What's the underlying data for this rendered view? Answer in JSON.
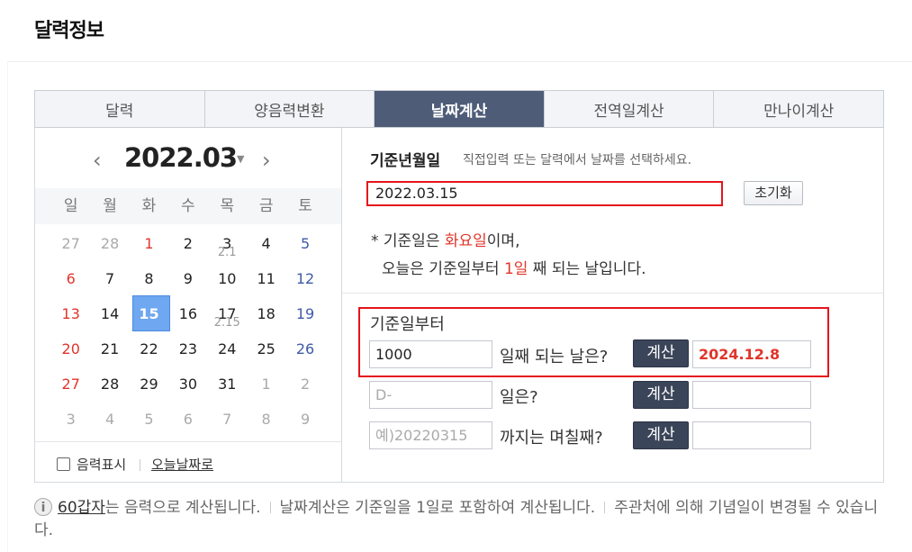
{
  "page_title": "달력정보",
  "tabs": [
    {
      "label": "달력",
      "active": false
    },
    {
      "label": "양음력변환",
      "active": false
    },
    {
      "label": "날짜계산",
      "active": true
    },
    {
      "label": "전역일계산",
      "active": false
    },
    {
      "label": "만나이계산",
      "active": false
    }
  ],
  "calendar": {
    "month_label": "2022.03",
    "prev_icon": "chevron-left-icon",
    "next_icon": "chevron-right-icon",
    "weekdays": [
      "일",
      "월",
      "화",
      "수",
      "목",
      "금",
      "토"
    ],
    "weeks": [
      [
        {
          "d": "27",
          "c": "muted"
        },
        {
          "d": "28",
          "c": "muted"
        },
        {
          "d": "1",
          "c": "red"
        },
        {
          "d": "2",
          "c": "normal"
        },
        {
          "d": "3",
          "c": "normal",
          "lunar": "2.1"
        },
        {
          "d": "4",
          "c": "normal"
        },
        {
          "d": "5",
          "c": "blue"
        }
      ],
      [
        {
          "d": "6",
          "c": "red"
        },
        {
          "d": "7",
          "c": "normal"
        },
        {
          "d": "8",
          "c": "normal"
        },
        {
          "d": "9",
          "c": "normal"
        },
        {
          "d": "10",
          "c": "normal"
        },
        {
          "d": "11",
          "c": "normal"
        },
        {
          "d": "12",
          "c": "blue"
        }
      ],
      [
        {
          "d": "13",
          "c": "red"
        },
        {
          "d": "14",
          "c": "normal"
        },
        {
          "d": "15",
          "c": "normal",
          "selected": true
        },
        {
          "d": "16",
          "c": "normal"
        },
        {
          "d": "17",
          "c": "normal",
          "lunar": "2.15"
        },
        {
          "d": "18",
          "c": "normal"
        },
        {
          "d": "19",
          "c": "blue"
        }
      ],
      [
        {
          "d": "20",
          "c": "red"
        },
        {
          "d": "21",
          "c": "normal"
        },
        {
          "d": "22",
          "c": "normal"
        },
        {
          "d": "23",
          "c": "normal"
        },
        {
          "d": "24",
          "c": "normal"
        },
        {
          "d": "25",
          "c": "normal"
        },
        {
          "d": "26",
          "c": "blue"
        }
      ],
      [
        {
          "d": "27",
          "c": "red"
        },
        {
          "d": "28",
          "c": "normal"
        },
        {
          "d": "29",
          "c": "normal"
        },
        {
          "d": "30",
          "c": "normal"
        },
        {
          "d": "31",
          "c": "normal"
        },
        {
          "d": "1",
          "c": "muted"
        },
        {
          "d": "2",
          "c": "muted"
        }
      ],
      [
        {
          "d": "3",
          "c": "muted"
        },
        {
          "d": "4",
          "c": "muted"
        },
        {
          "d": "5",
          "c": "muted"
        },
        {
          "d": "6",
          "c": "muted"
        },
        {
          "d": "7",
          "c": "muted"
        },
        {
          "d": "8",
          "c": "muted"
        },
        {
          "d": "9",
          "c": "muted"
        }
      ]
    ],
    "lunar_checkbox_label": "음력표시",
    "today_link": "오늘날짜로"
  },
  "base": {
    "label": "기준년월일",
    "hint": "직접입력 또는 달력에서 날짜를 선택하세요.",
    "value": "2022.03.15",
    "reset_label": "초기화"
  },
  "message": {
    "line1_prefix": "* 기준일은 ",
    "weekday": "화요일",
    "line1_suffix": "이며,",
    "line2_prefix": "오늘은 기준일부터 ",
    "days": "1일",
    "line2_suffix": " 째 되는 날입니다."
  },
  "calc": {
    "from_label": "기준일부터",
    "calc_button": "계산",
    "rows": [
      {
        "value": "1000",
        "placeholder": "",
        "label": "일째 되는 날은?",
        "result": "2024.12.8"
      },
      {
        "value": "",
        "placeholder": "D-",
        "label": "일은?",
        "result": ""
      },
      {
        "value": "",
        "placeholder": "예)20220315",
        "label": "까지는 며칠째?",
        "result": ""
      }
    ]
  },
  "notice": {
    "icon": "info-icon",
    "link": "60갑자",
    "text1": "는 음력으로 계산됩니다.",
    "text2": "날짜계산은 기준일을 1일로 포함하여 계산됩니다.",
    "text3": "주관처에 의해 기념일이 변경될 수 있습니다."
  },
  "colors": {
    "accent": "#4e5c78",
    "highlight": "#e0352b",
    "selected_day": "#6fa7f0",
    "saturday": "#3e5aa8"
  }
}
